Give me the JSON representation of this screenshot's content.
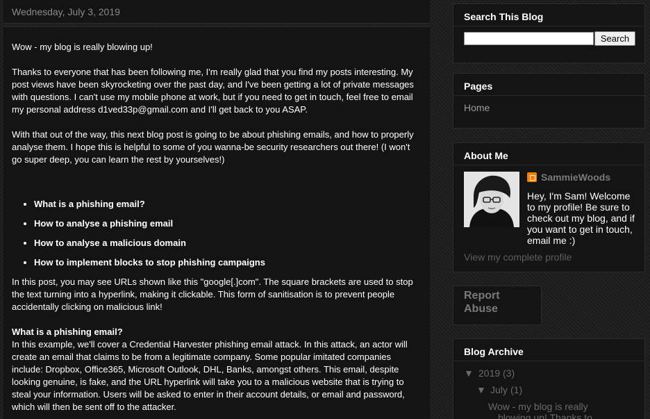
{
  "date_header": "Wednesday, July 3, 2019",
  "post": {
    "para1": "Wow - my blog is really blowing up!",
    "para2": "Thanks to everyone that has been following me, I'm really glad that you find my posts interesting. My post views have been skyrocketing over the past day, and I've been getting a lot of private messages with questions. I can't use my mobile phone at work, but if you need to get in touch, feel free to email my personal address d1ved33p@gmail.com and I'll get back to you ASAP.",
    "para3": "With that out of the way, this next blog post is going to be about phishing emails, and how to properly analyse them. I hope this is helpful to some of you wanna-be security researchers out there! (I won't go super deep, you can learn the rest by yourselves!)",
    "list": [
      "What is a phishing email?",
      "How to analyse a phishing email",
      "How to analyse a malicious domain",
      "How to implement blocks to stop phishing campaigns"
    ],
    "para4": "In this post, you may see URLs shown like this \"google[.]com\". The square brackets are used to stop the text turning into a hyperlink, making it clickable. This form of sanitisation is to prevent people accidentally clicking on malicious link!",
    "subheading": "What is a phishing email?",
    "para5": "In this example, we'll cover a Credential Harvester phishing email attack. In this attack, an actor will create an email that claims to be from a legitimate company. Some popular imitated companies include: Dropbox, Office365, Microsoft Outlook, DHL, Banks, amongst others. This email, despite looking genuine, is fake, and the URL hyperlink will take you to a malicious website that is trying to steal your information. Users will be asked to enter in their account details, or email and password, which will then be sent off to the attacker."
  },
  "sidebar": {
    "search": {
      "title": "Search This Blog",
      "button": "Search",
      "value": ""
    },
    "pages": {
      "title": "Pages",
      "home": "Home"
    },
    "about": {
      "title": "About Me",
      "name": "SammieWoods",
      "text": "Hey, I'm Sam! Welcome to my profile! Be sure to check out my blog, and if you want to get in touch, email me :)",
      "view_profile": "View my complete profile"
    },
    "report": {
      "line1": "Report",
      "line2": "Abuse"
    },
    "archive": {
      "title": "Blog Archive",
      "year_toggle": "▼",
      "year": "2019",
      "year_count": "(3)",
      "month_toggle": "▼",
      "month": "July",
      "month_count": "(1)",
      "post_line1": "Wow - my blog is really",
      "post_line2": "blowing up! Thanks to"
    }
  }
}
